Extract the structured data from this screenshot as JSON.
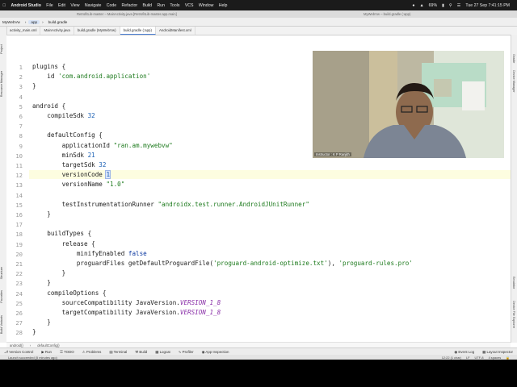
{
  "menubar": {
    "apple_icon": "apple-icon",
    "app_name": "Android Studio",
    "items": [
      "File",
      "Edit",
      "View",
      "Navigate",
      "Code",
      "Refactor",
      "Build",
      "Run",
      "Tools",
      "VCS",
      "Window",
      "Help"
    ],
    "battery": "69%",
    "datetime": "Tue 27 Sep  7:41:15 PM"
  },
  "titlebar": {
    "left_title": "RetrofitLib-master – MainActivity.java [RetrofitLib-master.app.main]",
    "right_title": "MyWebVw – build.gradle (:app)"
  },
  "nav": {
    "project": "MyWebVw",
    "module": "app",
    "file": "build.gradle"
  },
  "tabs": [
    {
      "label": "activity_main.xml",
      "active": false
    },
    {
      "label": "MainActivity.java",
      "active": false
    },
    {
      "label": "build.gradle (MyWebVw)",
      "active": false
    },
    {
      "label": "build.gradle (:app)",
      "active": true
    },
    {
      "label": "AndroidManifest.xml",
      "active": false
    }
  ],
  "left_strip": [
    "Project",
    "Resource Manager",
    "Structure",
    "Favorites",
    "Build Variants"
  ],
  "right_strip": [
    "Gradle",
    "Device Manager",
    "Emulator",
    "Device File Explorer"
  ],
  "code": [
    {
      "n": "1",
      "parts": [
        {
          "t": "plugins {",
          "c": ""
        }
      ]
    },
    {
      "n": "2",
      "parts": [
        {
          "t": "    id ",
          "c": ""
        },
        {
          "t": "'com.android.application'",
          "c": "str"
        }
      ]
    },
    {
      "n": "3",
      "parts": [
        {
          "t": "}",
          "c": ""
        }
      ]
    },
    {
      "n": "4",
      "parts": []
    },
    {
      "n": "5",
      "parts": [
        {
          "t": "android {",
          "c": ""
        }
      ]
    },
    {
      "n": "6",
      "parts": [
        {
          "t": "    compileSdk ",
          "c": ""
        },
        {
          "t": "32",
          "c": "num"
        }
      ]
    },
    {
      "n": "7",
      "parts": []
    },
    {
      "n": "8",
      "parts": [
        {
          "t": "    defaultConfig {",
          "c": ""
        }
      ]
    },
    {
      "n": "9",
      "parts": [
        {
          "t": "        applicationId ",
          "c": ""
        },
        {
          "t": "\"ran.am.mywebvw\"",
          "c": "str"
        }
      ]
    },
    {
      "n": "10",
      "parts": [
        {
          "t": "        minSdk ",
          "c": ""
        },
        {
          "t": "21",
          "c": "num"
        }
      ]
    },
    {
      "n": "11",
      "parts": [
        {
          "t": "        targetSdk ",
          "c": ""
        },
        {
          "t": "32",
          "c": "num"
        }
      ]
    },
    {
      "n": "12",
      "parts": [
        {
          "t": "        versionCode ",
          "c": ""
        },
        {
          "t": "1",
          "c": "num caret"
        }
      ]
    },
    {
      "n": "13",
      "parts": [
        {
          "t": "        versionName ",
          "c": ""
        },
        {
          "t": "\"1.0\"",
          "c": "str"
        }
      ]
    },
    {
      "n": "14",
      "parts": []
    },
    {
      "n": "15",
      "parts": [
        {
          "t": "        testInstrumentationRunner ",
          "c": ""
        },
        {
          "t": "\"androidx.test.runner.AndroidJUnitRunner\"",
          "c": "str"
        }
      ]
    },
    {
      "n": "16",
      "parts": [
        {
          "t": "    }",
          "c": ""
        }
      ]
    },
    {
      "n": "17",
      "parts": []
    },
    {
      "n": "18",
      "parts": [
        {
          "t": "    buildTypes {",
          "c": ""
        }
      ]
    },
    {
      "n": "19",
      "parts": [
        {
          "t": "        release {",
          "c": ""
        }
      ]
    },
    {
      "n": "20",
      "parts": [
        {
          "t": "            minifyEnabled ",
          "c": ""
        },
        {
          "t": "false",
          "c": "kw"
        }
      ]
    },
    {
      "n": "21",
      "parts": [
        {
          "t": "            proguardFiles getDefaultProguardFile(",
          "c": ""
        },
        {
          "t": "'proguard-android-optimize.txt'",
          "c": "str"
        },
        {
          "t": "), ",
          "c": ""
        },
        {
          "t": "'proguard-rules.pro'",
          "c": "str"
        }
      ]
    },
    {
      "n": "22",
      "parts": [
        {
          "t": "        }",
          "c": ""
        }
      ]
    },
    {
      "n": "23",
      "parts": [
        {
          "t": "    }",
          "c": ""
        }
      ]
    },
    {
      "n": "24",
      "parts": [
        {
          "t": "    compileOptions {",
          "c": ""
        }
      ]
    },
    {
      "n": "25",
      "parts": [
        {
          "t": "        sourceCompatibility JavaVersion.",
          "c": ""
        },
        {
          "t": "VERSION_1_8",
          "c": "const"
        }
      ]
    },
    {
      "n": "26",
      "parts": [
        {
          "t": "        targetCompatibility JavaVersion.",
          "c": ""
        },
        {
          "t": "VERSION_1_8",
          "c": "const"
        }
      ]
    },
    {
      "n": "27",
      "parts": [
        {
          "t": "    }",
          "c": ""
        }
      ]
    },
    {
      "n": "28",
      "parts": [
        {
          "t": "}",
          "c": ""
        }
      ]
    }
  ],
  "current_line": "12",
  "breadcrumb": [
    "android{}",
    "defaultConfig{}"
  ],
  "tool_buttons": [
    "Version Control",
    "Run",
    "TODO",
    "Problems",
    "Terminal",
    "Build",
    "Logcat",
    "Profiler",
    "App Inspection"
  ],
  "tool_buttons_right": [
    "Event Log",
    "Layout Inspector"
  ],
  "status": {
    "message": "Launch succeeded (5 minutes ago)",
    "position": "12:22 (1 char)",
    "line_sep": "LF",
    "encoding": "UTF-8",
    "indent": "4 spaces"
  },
  "webcam": {
    "label": "Instructor : K P Ranjith"
  },
  "colors": {
    "accent": "#4a7fd4",
    "string": "#1d7a1d",
    "number": "#1a5fb4",
    "keyword": "#0a37a0",
    "constant": "#8a2fa8"
  }
}
